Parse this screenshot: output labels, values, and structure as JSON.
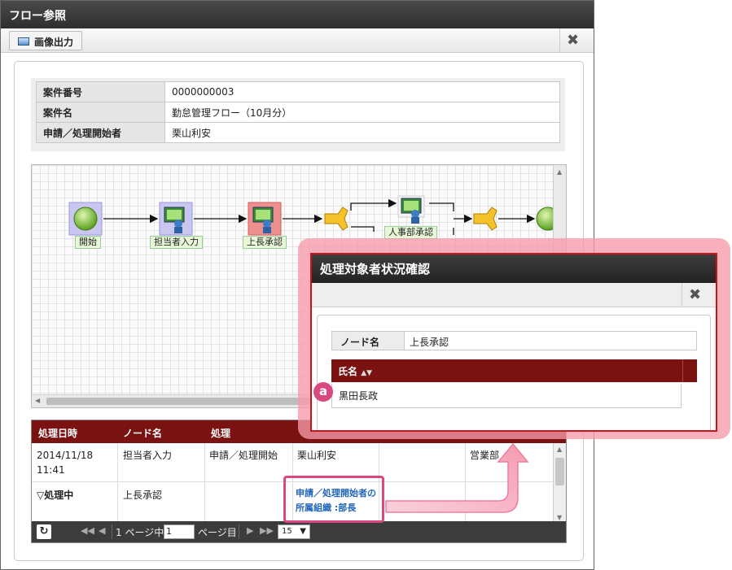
{
  "window": {
    "title": "フロー参照"
  },
  "toolbar": {
    "export_label": "画像出力"
  },
  "info": {
    "rows": [
      {
        "key": "案件番号",
        "value": "0000000003"
      },
      {
        "key": "案件名",
        "value": "勤怠管理フロー（10月分）"
      },
      {
        "key": "申請／処理開始者",
        "value": "栗山利安"
      }
    ]
  },
  "flow": {
    "nodes": [
      {
        "label": "開始"
      },
      {
        "label": "担当者入力"
      },
      {
        "label": "上長承認"
      },
      {
        "label": "人事部承認"
      }
    ]
  },
  "grid": {
    "headers": [
      "処理日時",
      "ノード名",
      "処理"
    ],
    "rows": [
      {
        "datetime": "2014/11/18 11:41",
        "node": "担当者入力",
        "action": "申請／処理開始",
        "user": "栗山利安",
        "dept": "営業部"
      },
      {
        "datetime": "▽処理中",
        "node": "上長承認"
      }
    ],
    "pager": {
      "page_prefix": "1 ページ中",
      "page_value": "1",
      "page_suffix": "ページ目",
      "page_size": "15"
    }
  },
  "callout": {
    "text": "申請／処理開始者の所属組織 :部長"
  },
  "popup": {
    "title": "処理対象者状況確認",
    "node_key": "ノード名",
    "node_value": "上長承認",
    "column_header": "氏名",
    "rows": [
      "黒田長政"
    ],
    "badge": "a"
  },
  "colors": {
    "header_dark": "#2e2e2e",
    "grid_header": "#7a1212",
    "accent_pink": "#d9487e",
    "popup_border": "#c0161c"
  }
}
